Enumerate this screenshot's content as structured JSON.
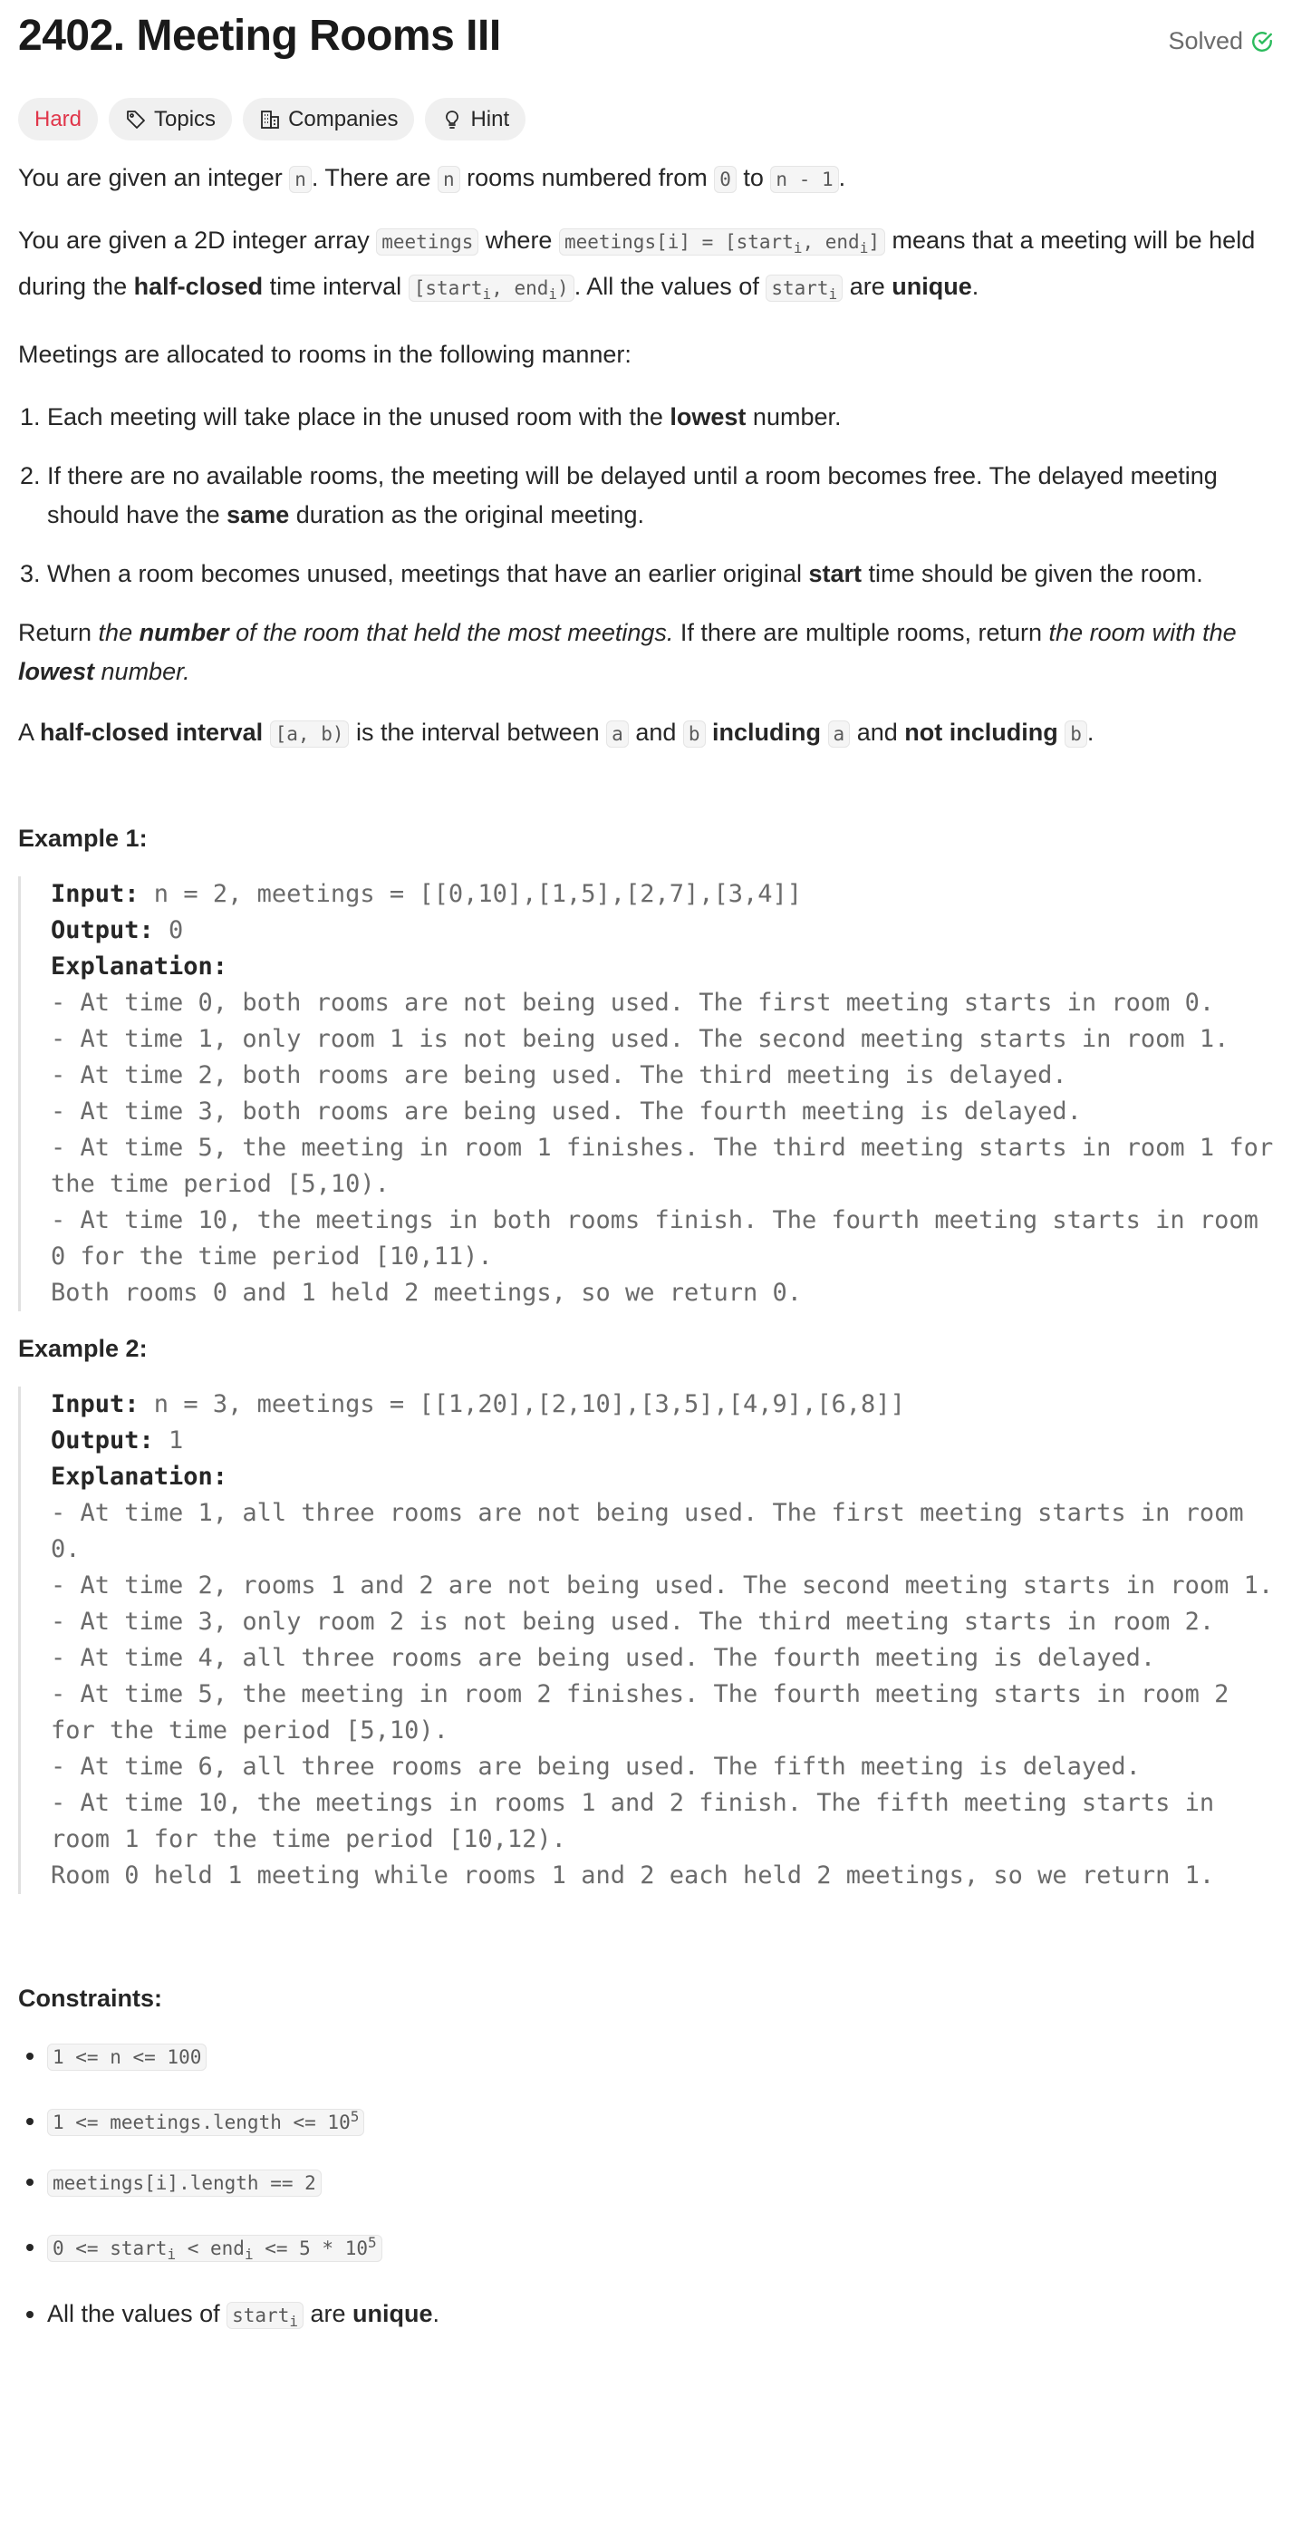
{
  "problem": {
    "title": "2402. Meeting Rooms III",
    "status": "Solved"
  },
  "tags": {
    "difficulty": "Hard",
    "topics": "Topics",
    "companies": "Companies",
    "hint": "Hint"
  },
  "description": {
    "p1": {
      "a": "You are given an integer ",
      "code_n": "n",
      "b": ". There are ",
      "code_n2": "n",
      "c": " rooms numbered from ",
      "code_0": "0",
      "d": " to ",
      "code_n1": "n - 1",
      "e": "."
    },
    "p2": {
      "a": "You are given a 2D integer array ",
      "code_meetings": "meetings",
      "b": " where ",
      "code_mi": "meetings[i] = [start",
      "sub1": "i",
      "code_mi2": ", end",
      "sub2": "i",
      "code_mi3": "]",
      "c": " means that a meeting will be held during the ",
      "bold": "half-closed",
      "d": " time interval ",
      "code_int": "[start",
      "sub3": "i",
      "code_int2": ", end",
      "sub4": "i",
      "code_int3": ")",
      "e": ". All the values of ",
      "code_start": "start",
      "sub5": "i",
      "f": " are ",
      "bold2": "unique",
      "g": "."
    },
    "p3": "Meetings are allocated to rooms in the following manner:",
    "rules": [
      {
        "a": "Each meeting will take place in the unused room with the ",
        "b": "lowest",
        "c": " number."
      },
      {
        "a": "If there are no available rooms, the meeting will be delayed until a room becomes free. The delayed meeting should have the ",
        "b": "same",
        "c": " duration as the original meeting."
      },
      {
        "a": "When a room becomes unused, meetings that have an earlier original ",
        "b": "start",
        "c": " time should be given the room."
      }
    ],
    "p4": {
      "a": "Return ",
      "i1": "the ",
      "bi": "number",
      "i2": " of the room that held the most meetings.",
      "b": " If there are multiple rooms, return ",
      "i3": "the room with the ",
      "bi2": "lowest",
      "i4": " number."
    },
    "p5": {
      "a": "A ",
      "bold": "half-closed interval",
      "b": " ",
      "code": "[a, b)",
      "c": " is the interval between ",
      "code_a": "a",
      "d": " and ",
      "code_b": "b",
      "e": " ",
      "bold2": "including",
      "f": " ",
      "code_a2": "a",
      "g": " and ",
      "bold3": "not including",
      "h": " ",
      "code_b2": "b",
      "i": "."
    }
  },
  "example1": {
    "heading": "Example 1:",
    "input_label": "Input:",
    "input": " n = 2, meetings = [[0,10],[1,5],[2,7],[3,4]]",
    "output_label": "Output:",
    "output": " 0",
    "explanation_label": "Explanation:",
    "explanation": "- At time 0, both rooms are not being used. The first meeting starts in room 0.\n- At time 1, only room 1 is not being used. The second meeting starts in room 1.\n- At time 2, both rooms are being used. The third meeting is delayed.\n- At time 3, both rooms are being used. The fourth meeting is delayed.\n- At time 5, the meeting in room 1 finishes. The third meeting starts in room 1 for the time period [5,10).\n- At time 10, the meetings in both rooms finish. The fourth meeting starts in room 0 for the time period [10,11).\nBoth rooms 0 and 1 held 2 meetings, so we return 0."
  },
  "example2": {
    "heading": "Example 2:",
    "input_label": "Input:",
    "input": " n = 3, meetings = [[1,20],[2,10],[3,5],[4,9],[6,8]]",
    "output_label": "Output:",
    "output": " 1",
    "explanation_label": "Explanation:",
    "explanation": "- At time 1, all three rooms are not being used. The first meeting starts in room 0.\n- At time 2, rooms 1 and 2 are not being used. The second meeting starts in room 1.\n- At time 3, only room 2 is not being used. The third meeting starts in room 2.\n- At time 4, all three rooms are being used. The fourth meeting is delayed.\n- At time 5, the meeting in room 2 finishes. The fourth meeting starts in room 2 for the time period [5,10).\n- At time 6, all three rooms are being used. The fifth meeting is delayed.\n- At time 10, the meetings in rooms 1 and 2 finish. The fifth meeting starts in room 1 for the time period [10,12).\nRoom 0 held 1 meeting while rooms 1 and 2 each held 2 meetings, so we return 1."
  },
  "constraints": {
    "heading": "Constraints:",
    "c1": "1 <= n <= 100",
    "c2": "1 <= meetings.length <= 10",
    "c2_sup": "5",
    "c3": "meetings[i].length == 2",
    "c4a": "0 <= start",
    "c4_sub1": "i",
    "c4b": " < end",
    "c4_sub2": "i",
    "c4c": " <= 5 * 10",
    "c4_sup": "5",
    "c5a": "All the values of ",
    "c5_code": "start",
    "c5_sub": "i",
    "c5b": " are ",
    "c5_bold": "unique",
    "c5c": "."
  },
  "colors": {
    "hard": "#e0364a",
    "solved_check": "#2cbb5d"
  }
}
